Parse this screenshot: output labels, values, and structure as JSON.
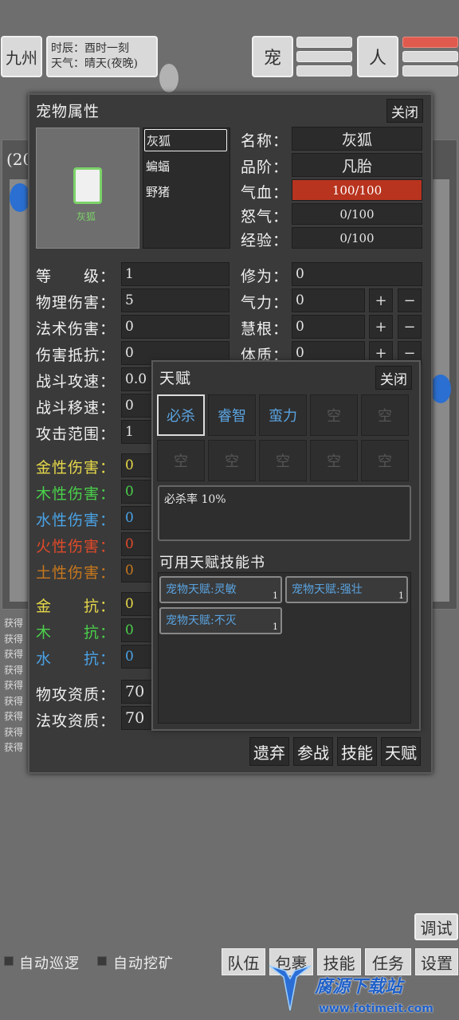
{
  "topbar": {
    "location": "九州",
    "time_label": "时辰：酉时一刻",
    "weather_label": "天气：晴天(夜晚)",
    "pet_button": "宠",
    "person_button": "人"
  },
  "background": {
    "partial_label": "(20",
    "log_entries": [
      "获得",
      "获得",
      "获得",
      "获得",
      "获得",
      "获得",
      "获得",
      "获得",
      "获得"
    ]
  },
  "pet_panel": {
    "title": "宠物属性",
    "close": "关闭",
    "preview_name": "灰狐",
    "pets": [
      "灰狐",
      "蝙蝠",
      "野猪"
    ],
    "info": [
      {
        "label": "名称：",
        "value": "灰狐"
      },
      {
        "label": "品阶：",
        "value": "凡胎"
      },
      {
        "label": "气血：",
        "value": "100/100"
      },
      {
        "label": "怒气：",
        "value": "0/100"
      },
      {
        "label": "经验：",
        "value": "0/100"
      }
    ],
    "hp_fraction": 1.0,
    "left_stats": [
      {
        "label": "等　　级：",
        "value": "1",
        "color": "#f0f0f0"
      },
      {
        "label": "物理伤害：",
        "value": "5",
        "color": "#f0f0f0"
      },
      {
        "label": "法术伤害：",
        "value": "0",
        "color": "#f0f0f0"
      },
      {
        "label": "伤害抵抗：",
        "value": "0",
        "color": "#f0f0f0"
      },
      {
        "label": "战斗攻速：",
        "value": "0.0",
        "color": "#f0f0f0"
      },
      {
        "label": "战斗移速：",
        "value": "0",
        "color": "#f0f0f0"
      },
      {
        "label": "攻击范围：",
        "value": "1",
        "color": "#f0f0f0"
      }
    ],
    "element_dmg": [
      {
        "label": "金性伤害：",
        "value": "0",
        "color": "#e6d84a"
      },
      {
        "label": "木性伤害：",
        "value": "0",
        "color": "#4ad04a"
      },
      {
        "label": "水性伤害：",
        "value": "0",
        "color": "#4aa3e6"
      },
      {
        "label": "火性伤害：",
        "value": "0",
        "color": "#e04a2a"
      },
      {
        "label": "土性伤害：",
        "value": "0",
        "color": "#c8781e"
      }
    ],
    "element_res": [
      {
        "label": "金　　抗：",
        "value": "0",
        "color": "#e6d84a"
      },
      {
        "label": "木　　抗：",
        "value": "0",
        "color": "#4ad04a"
      },
      {
        "label": "水　　抗：",
        "value": "0",
        "color": "#4aa3e6"
      }
    ],
    "aptitude": [
      {
        "label": "物攻资质：",
        "value": "70"
      },
      {
        "label": "法攻资质：",
        "value": "70"
      }
    ],
    "right_stats": [
      {
        "label": "修为：",
        "value": "0"
      },
      {
        "label": "气力：",
        "value": "0"
      },
      {
        "label": "慧根：",
        "value": "0"
      },
      {
        "label": "体质：",
        "value": "0"
      }
    ],
    "plus": "+",
    "minus": "−",
    "bottom_buttons": [
      "遗弃",
      "参战",
      "技能",
      "天赋"
    ]
  },
  "talent_panel": {
    "title": "天赋",
    "close": "关闭",
    "slots": [
      "必杀",
      "睿智",
      "蛮力",
      "空",
      "空",
      "空",
      "空",
      "空",
      "空",
      "空"
    ],
    "desc": "必杀率 10%",
    "books_title": "可用天赋技能书",
    "books": [
      {
        "name": "宠物天赋:灵敏",
        "count": "1"
      },
      {
        "name": "宠物天赋:强壮",
        "count": "1"
      },
      {
        "name": "宠物天赋:不灭",
        "count": "1"
      }
    ]
  },
  "bottom": {
    "debug": "调试",
    "auto_patrol": "自动巡逻",
    "auto_mine": "自动挖矿",
    "nav": [
      "队伍",
      "包裹",
      "技能",
      "任务",
      "设置"
    ]
  },
  "watermark": {
    "text": "腐源下载站",
    "url": "www.fotimeit.com"
  },
  "colors": {
    "accent_red": "#b8341f",
    "talent_blue": "#5aa3e0"
  }
}
